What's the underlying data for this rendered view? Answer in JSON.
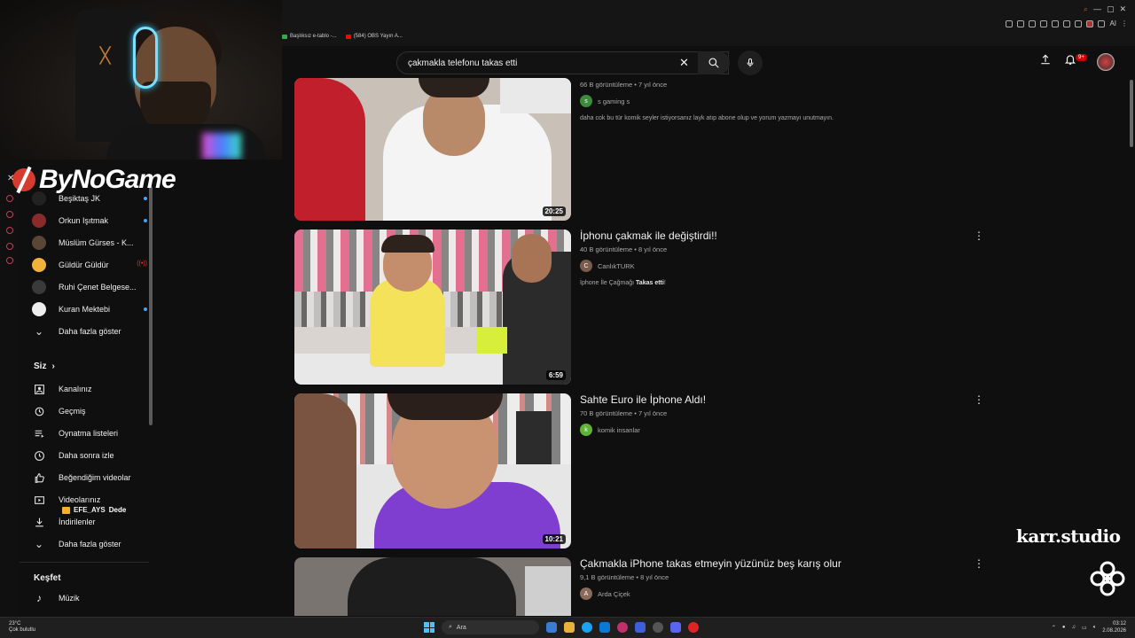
{
  "bookmarks": [
    {
      "label": "Başlıksız e-tablo -...",
      "color": "#34a853"
    },
    {
      "label": "(584) OBS Yayın A...",
      "color": "#ff0000"
    }
  ],
  "window_controls": {
    "search": "⌕",
    "minimize": "—",
    "maximize": "▢",
    "close": "✕"
  },
  "extensions": {
    "ai_label": "AI"
  },
  "overlay": {
    "streamer_logo": "ByNoGame",
    "watermark": "karr.studio",
    "chat": {
      "user": "EFE_AYS",
      "message": "Dede"
    }
  },
  "search": {
    "query": "çakmakla telefonu takas etti"
  },
  "header": {
    "notification_count": "9+"
  },
  "sidebar": {
    "subscriptions": [
      {
        "label": "Beşiktaş JK",
        "avatar_color": "#222",
        "indicator": "dot"
      },
      {
        "label": "Orkun Işıtmak",
        "avatar_color": "#8a2b2b",
        "indicator": "dot"
      },
      {
        "label": "Müslüm Gürses - K...",
        "avatar_color": "#5a4636",
        "indicator": "none"
      },
      {
        "label": "Güldür Güldür",
        "avatar_color": "#f0b23a",
        "indicator": "live"
      },
      {
        "label": "Ruhi Çenet Belgese...",
        "avatar_color": "#3a3a3a",
        "indicator": "none"
      },
      {
        "label": "Kuran Mektebi",
        "avatar_color": "#eeeeee",
        "indicator": "dot"
      }
    ],
    "show_more_1": "Daha fazla göster",
    "you_section": "Siz",
    "you_items": [
      {
        "label": "Kanalınız",
        "icon": "channel-icon"
      },
      {
        "label": "Geçmiş",
        "icon": "history-icon"
      },
      {
        "label": "Oynatma listeleri",
        "icon": "playlist-icon"
      },
      {
        "label": "Daha sonra izle",
        "icon": "clock-icon"
      },
      {
        "label": "Beğendiğim videolar",
        "icon": "like-icon"
      },
      {
        "label": "Videolarınız",
        "icon": "video-icon"
      },
      {
        "label": "İndirilenler",
        "icon": "download-icon"
      }
    ],
    "show_more_2": "Daha fazla göster",
    "explore_section": "Keşfet",
    "explore_items": [
      {
        "label": "Müzik",
        "icon": "music-icon"
      }
    ]
  },
  "results": [
    {
      "title": "",
      "views": "66 B görüntüleme",
      "age": "7 yıl önce",
      "channel": "s gaming s",
      "channel_initial": "s",
      "channel_color": "#3d8b3d",
      "description": "daha cok bu tür komik seyler istiyorsanız layk atıp abone olup ve yorum yazmayı unutmayın.",
      "description_bold": "",
      "duration": "20:25"
    },
    {
      "title": "İphonu çakmak ile değiştirdi!!",
      "views": "40 B görüntüleme",
      "age": "8 yıl önce",
      "channel": "CanlıkTURK",
      "channel_initial": "C",
      "channel_color": "#7a5c4c",
      "description": "İphone İle Çağmağı ",
      "description_bold": "Takas etti",
      "description_tail": "!",
      "duration": "6:59"
    },
    {
      "title": "Sahte Euro ile İphone Aldı!",
      "views": "70 B görüntüleme",
      "age": "7 yıl önce",
      "channel": "komik insanlar",
      "channel_initial": "k",
      "channel_color": "#5fb336",
      "description": "",
      "duration": "10:21"
    },
    {
      "title": "Çakmakla iPhone takas etmeyin yüzünüz beş karış olur",
      "views": "9,1 B görüntüleme",
      "age": "8 yıl önce",
      "channel": "Arda Çiçek",
      "channel_initial": "A",
      "channel_color": "#8a6a5a",
      "description": "",
      "duration": ""
    }
  ],
  "taskbar": {
    "weather_temp": "23°C",
    "weather_desc": "Çok bulutlu",
    "search_placeholder": "Ara",
    "time": "03:12",
    "date": "2.08.2026"
  },
  "colors": {
    "background": "#0f0f0f",
    "accent_blue": "#3ea6ff",
    "youtube_red": "#cc0000"
  }
}
